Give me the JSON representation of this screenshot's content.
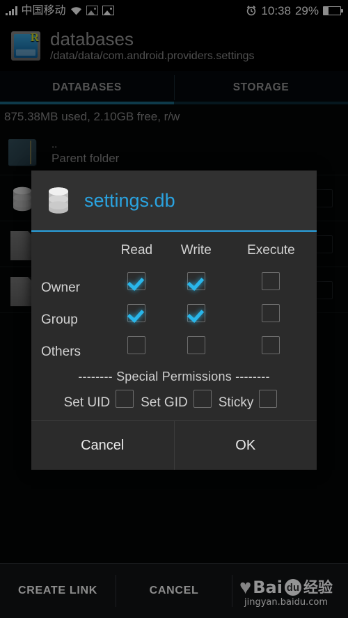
{
  "status_bar": {
    "signal_icon": "signal-bars-icon",
    "carrier": "中国移动",
    "wifi_icon": "wifi-icon",
    "image_icon_1": "image-icon",
    "image_icon_2": "image-icon",
    "alarm_icon": "alarm-clock-icon",
    "time": "10:38",
    "battery_percent": "29%",
    "battery_icon": "battery-icon",
    "battery_level": 29
  },
  "app_header": {
    "icon": "root-explorer-folder-icon",
    "icon_letter": "R",
    "title": "databases",
    "path": "/data/data/com.android.providers.settings"
  },
  "tabs": [
    {
      "label": "DATABASES",
      "active": true
    },
    {
      "label": "STORAGE",
      "active": false
    }
  ],
  "storage_info": "875.38MB used, 2.10GB free, r/w",
  "file_list": [
    {
      "icon": "folder-icon",
      "name": "..",
      "sub": "Parent folder",
      "checkbox": false
    },
    {
      "icon": "database-icon",
      "name": "",
      "sub": "",
      "checkbox": true
    },
    {
      "icon": "file-icon",
      "name": "",
      "sub": "",
      "checkbox": true
    },
    {
      "icon": "file-icon",
      "name": "",
      "sub": "",
      "checkbox": true
    }
  ],
  "dialog": {
    "icon": "database-icon",
    "title": "settings.db",
    "columns": [
      "Read",
      "Write",
      "Execute"
    ],
    "rows": [
      {
        "label": "Owner",
        "read": true,
        "write": true,
        "execute": false
      },
      {
        "label": "Group",
        "read": true,
        "write": true,
        "execute": false
      },
      {
        "label": "Others",
        "read": false,
        "write": false,
        "execute": false
      }
    ],
    "special_header": "-------- Special Permissions --------",
    "special": [
      {
        "label": "Set UID",
        "checked": false
      },
      {
        "label": "Set GID",
        "checked": false
      },
      {
        "label": "Sticky",
        "checked": false
      }
    ],
    "cancel_label": "Cancel",
    "ok_label": "OK"
  },
  "bottom_bar": {
    "create_link_label": "CREATE LINK",
    "cancel_label": "CANCEL"
  },
  "watermark": {
    "heart": "♥",
    "brand": "Bai",
    "badge": "du",
    "suffix": "经验",
    "url": "jingyan.baidu.com"
  },
  "colors": {
    "accent": "#2aa3e0",
    "check": "#29b6ea",
    "tab_active_underline": "#1b6a87",
    "dialog_bg": "#2b2b2b",
    "page_bg": "#050607"
  }
}
